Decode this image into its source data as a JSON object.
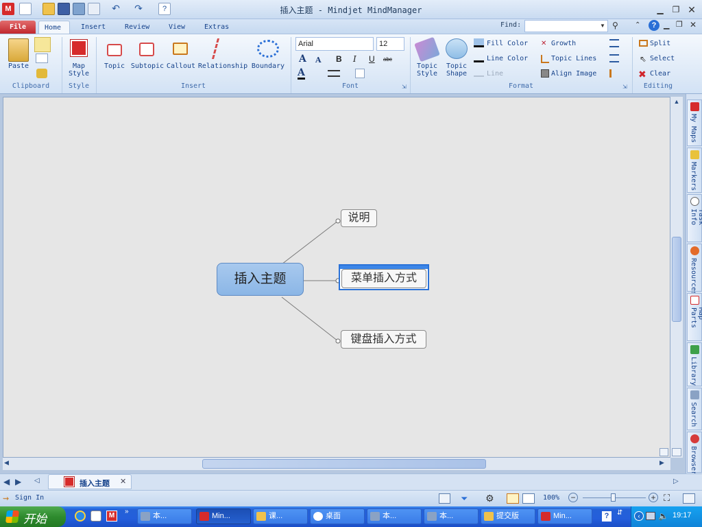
{
  "window": {
    "title": "插入主题 - Mindjet MindManager"
  },
  "ribbon_tabs": [
    "File",
    "Home",
    "Insert",
    "Review",
    "View",
    "Extras"
  ],
  "find": {
    "label": "Find:",
    "value": ""
  },
  "clipboard": {
    "paste": "Paste",
    "group": "Clipboard"
  },
  "style_group": {
    "map_style": "Map",
    "map_style2": "Style",
    "group": "Style"
  },
  "insert_group": {
    "topic": "Topic",
    "subtopic": "Subtopic",
    "callout": "Callout",
    "relationship": "Relationship",
    "boundary": "Boundary",
    "group": "Insert"
  },
  "font_group": {
    "font_name": "Arial",
    "font_size": "12",
    "bold": "B",
    "italic": "I",
    "underline": "U",
    "strike": "abc",
    "grow": "A",
    "shrink": "A",
    "color": "A",
    "group": "Font"
  },
  "format_group": {
    "topic_style": "Topic",
    "topic_style2": "Style",
    "topic_shape": "Topic",
    "topic_shape2": "Shape",
    "fill_color": "Fill Color",
    "line_color": "Line Color",
    "line": "Line",
    "growth": "Growth",
    "topic_lines": "Topic Lines",
    "align_image": "Align Image",
    "group": "Format"
  },
  "editing_group": {
    "split": "Split",
    "select": "Select",
    "clear": "Clear",
    "group": "Editing"
  },
  "side_tabs": [
    "My Maps",
    "Markers",
    "Task Info",
    "Resources",
    "Map Parts",
    "Library",
    "Search",
    "Browser"
  ],
  "map": {
    "central": "插入主题",
    "topics": [
      "说明",
      "菜单插入方式",
      "键盘插入方式"
    ]
  },
  "doc_tab": {
    "label": "插入主题"
  },
  "status": {
    "sign_in": "Sign In",
    "zoom": "100%"
  },
  "taskbar": {
    "start": "开始",
    "tasks": [
      "本...",
      "Min...",
      "课...",
      "桌面",
      "本...",
      "本...",
      "提交版",
      "Min..."
    ],
    "clock": "19:17"
  },
  "colors": {
    "accent": "#2a6fd6",
    "file_tab": "#c1272d",
    "central_fill": "#9cc0ea"
  }
}
